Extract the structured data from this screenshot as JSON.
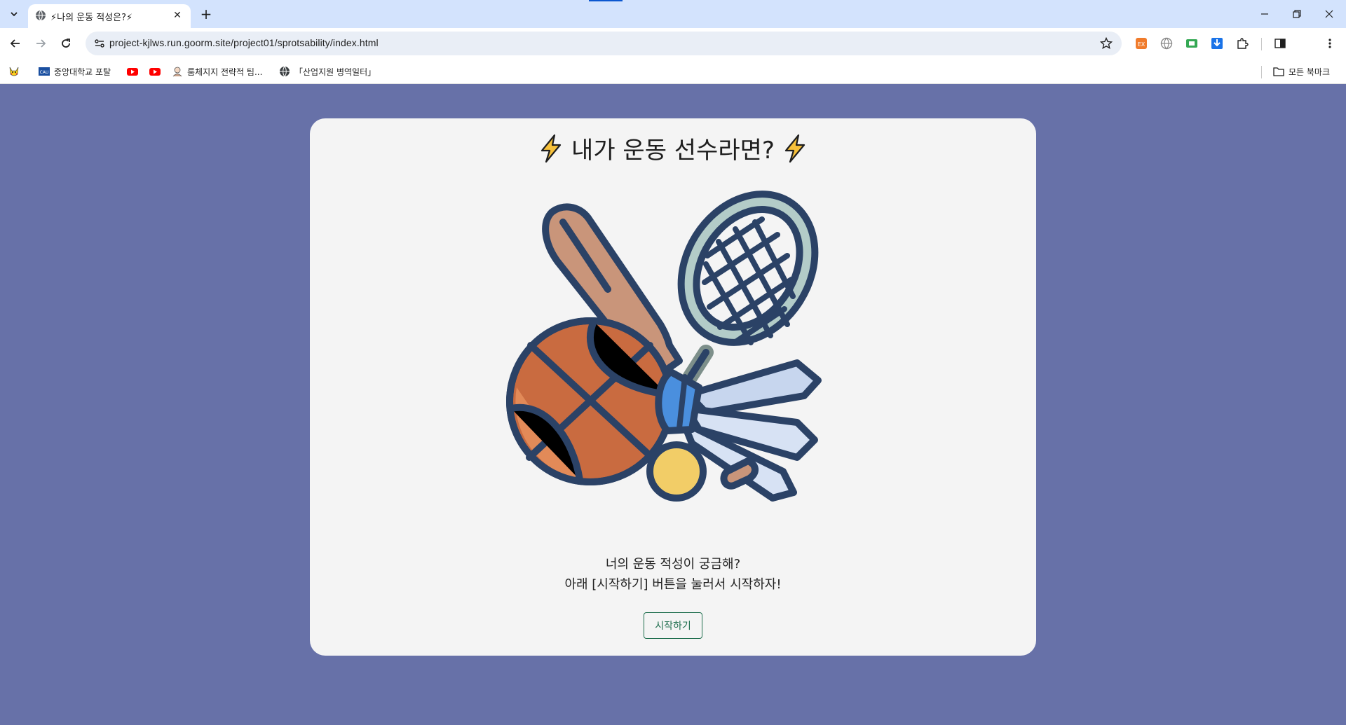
{
  "browser": {
    "tab": {
      "title": "⚡나의 운동 적성은?⚡",
      "close": "✕"
    },
    "new_tab": "+",
    "url": "project-kjlws.run.goorm.site/project01/sprotsability/index.html",
    "window": {
      "minimize": "–",
      "restore": "❐",
      "close": "✕"
    }
  },
  "bookmarks": {
    "items": [
      {
        "label": "",
        "icon": "pikachu-icon"
      },
      {
        "label": "중앙대학교 포탈",
        "icon": "cau-icon"
      },
      {
        "label": "",
        "icon": "youtube-icon"
      },
      {
        "label": "",
        "icon": "youtube-icon"
      },
      {
        "label": "룸체지지 전략적 팀...",
        "icon": "avatar-icon"
      },
      {
        "label": "「산업지원 병역일터」",
        "icon": "globe-icon"
      }
    ],
    "all_bookmarks": "모든 북마크"
  },
  "page": {
    "title": "내가 운동 선수라면?",
    "description_line1": "너의 운동 적성이 궁금해?",
    "description_line2": "아래 [시작하기] 버튼을 눌러서 시작하자!",
    "start_button": "시작하기",
    "colors": {
      "background": "#6771a8",
      "card": "#f4f4f4",
      "button_border": "#1f6e4e",
      "bolt": "#f7c13a"
    }
  }
}
